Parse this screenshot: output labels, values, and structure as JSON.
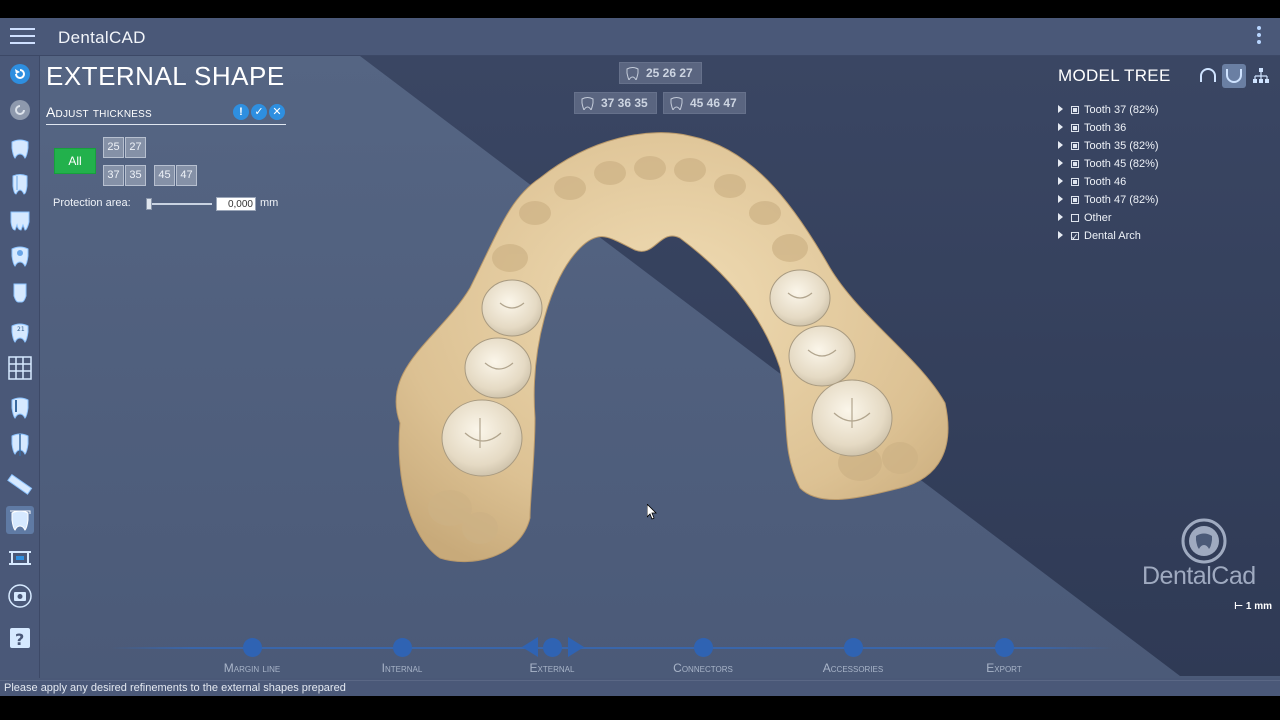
{
  "app": {
    "title": "DentalCAD"
  },
  "panel": {
    "title": "EXTERNAL SHAPE",
    "section": "Adjust thickness",
    "all_label": "All",
    "upper_teeth": [
      "25",
      "27"
    ],
    "lower_left": [
      "37",
      "35"
    ],
    "lower_right": [
      "45",
      "47"
    ],
    "protection_label": "Protection area:",
    "protection_value": "0,000",
    "protection_unit": "mm"
  },
  "chips": {
    "upper": "25 26 27",
    "lower_left": "37 36 35",
    "lower_right": "45 46 47"
  },
  "model_tree": {
    "title": "MODEL TREE",
    "items": [
      {
        "label": "Tooth 37 (82%)",
        "state": "filled"
      },
      {
        "label": "Tooth 36",
        "state": "filled"
      },
      {
        "label": "Tooth 35 (82%)",
        "state": "filled"
      },
      {
        "label": "Tooth 45 (82%)",
        "state": "filled"
      },
      {
        "label": "Tooth 46",
        "state": "filled"
      },
      {
        "label": "Tooth 47 (82%)",
        "state": "filled"
      },
      {
        "label": "Other",
        "state": "empty"
      },
      {
        "label": "Dental Arch",
        "state": "checked"
      }
    ]
  },
  "brand": {
    "name": "DentalCad",
    "scale": "1 mm"
  },
  "workflow": {
    "steps": [
      "Margin line",
      "Internal",
      "External",
      "Connectors",
      "Accessories",
      "Export"
    ],
    "current": "External"
  },
  "status": "Please apply any desired refinements to the external shapes prepared",
  "colors": {
    "accent": "#2f63b3",
    "all_button": "#22b14c",
    "model": "#e6cfa3",
    "background": "#4a5877"
  }
}
